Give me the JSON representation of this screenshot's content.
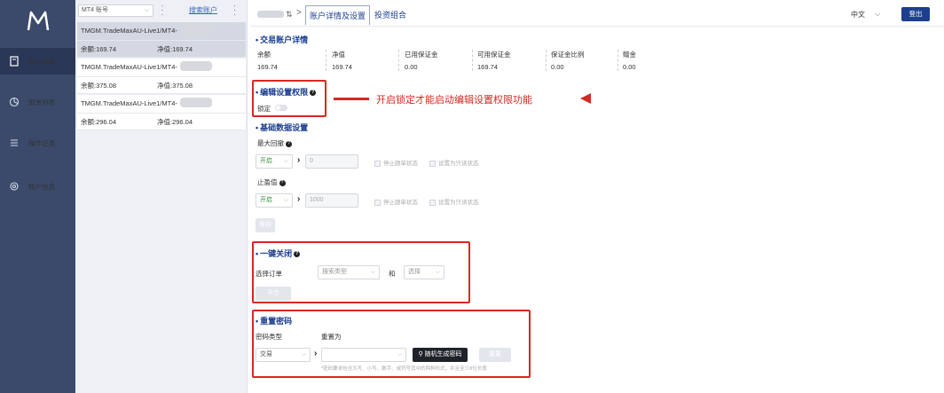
{
  "sidebar": {
    "logo_text": "M",
    "items": [
      {
        "label": "账户管理",
        "icon": "card-icon"
      },
      {
        "label": "跟单列表",
        "icon": "chart-icon"
      },
      {
        "label": "操作记录",
        "icon": "list-icon"
      },
      {
        "label": "账户信息",
        "icon": "gear-icon"
      }
    ]
  },
  "account_panel": {
    "select_value": "MT4 账号",
    "search_link": "搜索账户",
    "accounts": [
      {
        "name": "TMGM.TradeMaxAU-Live1/MT4-",
        "balance": "余额:169.74",
        "equity": "净值:169.74"
      },
      {
        "name": "TMGM.TradeMaxAU-Live1/MT4-",
        "balance": "余额:375.08",
        "equity": "净值:375.08"
      },
      {
        "name": "TMGM.TradeMaxAU-Live1/MT4-",
        "balance": "余额:296.04",
        "equity": "净值:296.04"
      }
    ]
  },
  "topbar": {
    "refresh_icon": "refresh-icon",
    "separator": ">",
    "tabs": [
      "账户详情及设置",
      "投资组合"
    ],
    "language": "中文",
    "logout": "登出"
  },
  "account_details": {
    "title": "交易账户详情",
    "columns": [
      {
        "label": "余额",
        "value": "169.74"
      },
      {
        "label": "净值",
        "value": "169.74"
      },
      {
        "label": "已用保证金",
        "value": "0.00"
      },
      {
        "label": "可用保证金",
        "value": "169.74"
      },
      {
        "label": "保证金比例",
        "value": "0.00"
      },
      {
        "label": "赠金",
        "value": "0.00"
      }
    ]
  },
  "edit_permission": {
    "title": "编辑设置权限",
    "lock_label": "锁定",
    "annotation": "开启锁定才能启动编辑设置权限功能"
  },
  "basic_settings": {
    "title": "基础数据设置",
    "max_drawdown": {
      "label": "最大回撤",
      "toggle": "开启",
      "value": "0",
      "check1": "停止跟单状态",
      "check2": "设置为只读状态"
    },
    "take_profit": {
      "label": "止盈值",
      "toggle": "开启",
      "value": "1000",
      "check1": "停止跟单状态",
      "check2": "设置为只读状态"
    },
    "save_button": "保存"
  },
  "one_click_close": {
    "title": "一键关闭",
    "select_label": "选择订单",
    "select1_placeholder": "搜索类型",
    "and_label": "和",
    "select2_placeholder": "选择",
    "close_button": "平仓"
  },
  "reset_password": {
    "title": "重置密码",
    "type_label": "密码类型",
    "reset_to_label": "重置为",
    "type_value": "交易",
    "generate_button": "随机生成密码",
    "reset_button": "重置",
    "hint": "*密码要求包含大写、小写、数字、或符号其中的两种形式，并且至少8位长度"
  }
}
